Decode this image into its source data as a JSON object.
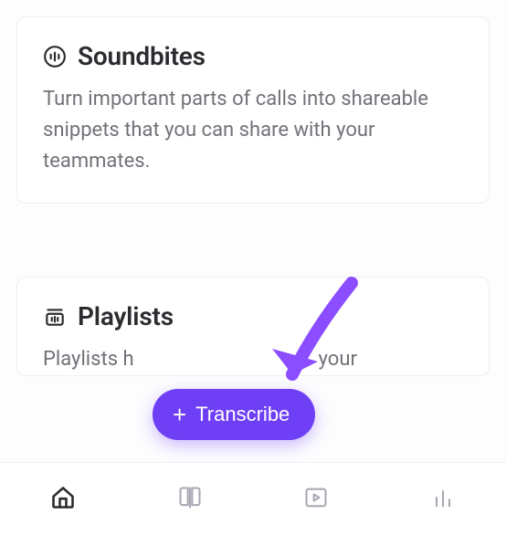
{
  "cards": {
    "soundbites": {
      "title": "Soundbites",
      "desc": "Turn important parts of calls into shareable snippets that you can share with your teammates."
    },
    "playlists": {
      "title": "Playlists",
      "desc": "Playlists h                                     your"
    }
  },
  "fab": {
    "label": "Transcribe"
  }
}
